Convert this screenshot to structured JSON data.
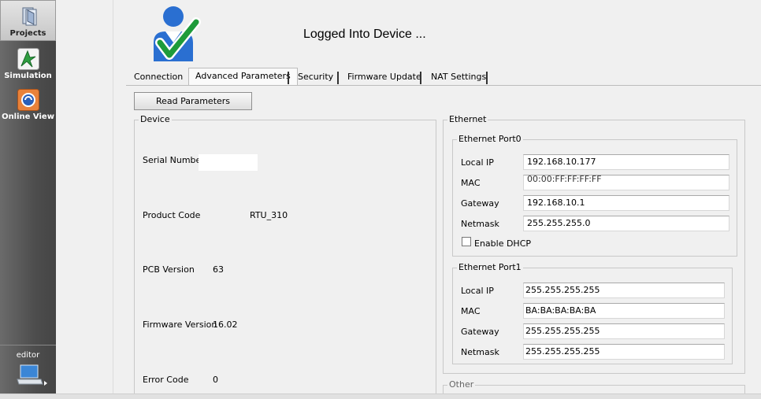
{
  "sidebar": {
    "items": [
      {
        "label": "Projects",
        "icon": "projects-icon"
      },
      {
        "label": "Simulation",
        "icon": "simulation-icon"
      },
      {
        "label": "Online View",
        "icon": "online-view-icon"
      }
    ],
    "editor_label": "editor"
  },
  "header": {
    "status": "Logged Into Device ...",
    "icon": "user-check-icon",
    "check_color": "#1e9b3a",
    "user_color": "#2a6fd1"
  },
  "tabs": [
    {
      "label": "Connection"
    },
    {
      "label": "Advanced Parameters"
    },
    {
      "label": "Security"
    },
    {
      "label": "Firmware Update"
    },
    {
      "label": "NAT Settings"
    }
  ],
  "selected_tab": "Advanced Parameters",
  "read_button": "Read  Parameters",
  "device": {
    "title": "Device",
    "serial_number": {
      "label": "Serial Number",
      "value": ""
    },
    "product_code": {
      "label": "Product Code",
      "value": "RTU_310"
    },
    "pcb_version": {
      "label": "PCB Version",
      "value": "63"
    },
    "firmware_version": {
      "label": "Firmware Version",
      "value": "16.02"
    },
    "error_code": {
      "label": "Error Code",
      "value": "0"
    }
  },
  "ethernet": {
    "title": "Ethernet",
    "port0": {
      "title": "Ethernet Port0",
      "local_ip": {
        "label": "Local IP",
        "value": "192.168.10.177"
      },
      "mac": {
        "label": "MAC",
        "value": "00:00:FF:FF:FF:FF"
      },
      "gateway": {
        "label": "Gateway",
        "value": "192.168.10.1"
      },
      "netmask": {
        "label": "Netmask",
        "value": "255.255.255.0"
      },
      "dhcp": {
        "label": "Enable DHCP",
        "checked": false
      }
    },
    "port1": {
      "title": "Ethernet Port1",
      "local_ip": {
        "label": "Local IP",
        "value": "255.255.255.255"
      },
      "mac": {
        "label": "MAC",
        "value": "BA:BA:BA:BA:BA"
      },
      "gateway": {
        "label": "Gateway",
        "value": "255.255.255.255"
      },
      "netmask": {
        "label": "Netmask",
        "value": "255.255.255.255"
      }
    }
  },
  "other": {
    "title": "Other"
  }
}
